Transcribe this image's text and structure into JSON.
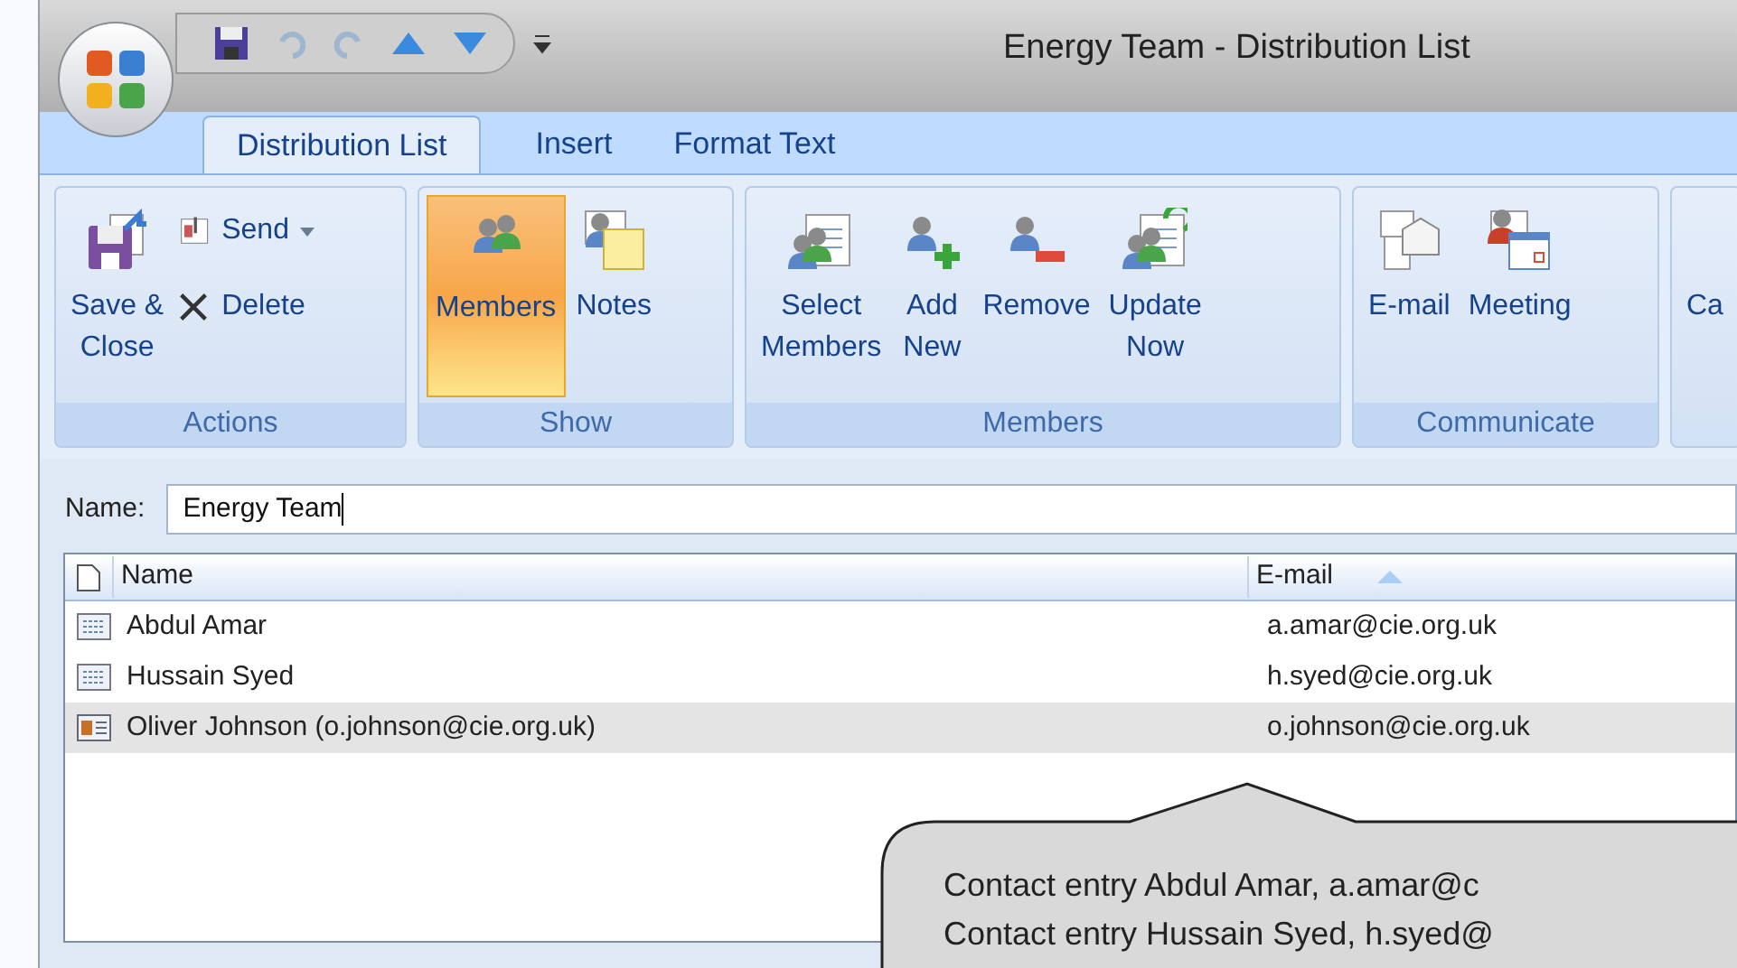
{
  "window": {
    "title": "Energy Team - Distribution List"
  },
  "tabs": [
    {
      "label": "Distribution List",
      "selected": true
    },
    {
      "label": "Insert",
      "selected": false
    },
    {
      "label": "Format Text",
      "selected": false
    }
  ],
  "ribbon": {
    "groups": [
      {
        "label": "Actions",
        "buttons": [
          {
            "kind": "large",
            "label": "Save &\nClose",
            "selected": false
          },
          {
            "kind": "small",
            "label": "Send",
            "dropdown": true,
            "selected": false
          },
          {
            "kind": "small",
            "label": "Delete",
            "dropdown": false,
            "selected": false
          }
        ]
      },
      {
        "label": "Show",
        "buttons": [
          {
            "kind": "large",
            "label": "Members",
            "selected": true
          },
          {
            "kind": "large",
            "label": "Notes",
            "selected": false
          }
        ]
      },
      {
        "label": "Members",
        "buttons": [
          {
            "kind": "large",
            "label": "Select\nMembers",
            "selected": false
          },
          {
            "kind": "large",
            "label": "Add\nNew",
            "selected": false
          },
          {
            "kind": "large",
            "label": "Remove",
            "selected": false
          },
          {
            "kind": "large",
            "label": "Update\nNow",
            "selected": false
          }
        ]
      },
      {
        "label": "Communicate",
        "buttons": [
          {
            "kind": "large",
            "label": "E-mail",
            "selected": false
          },
          {
            "kind": "large",
            "label": "Meeting",
            "selected": false
          }
        ]
      },
      {
        "buttons": [
          {
            "kind": "large",
            "label": "Ca",
            "selected": false
          }
        ]
      }
    ]
  },
  "name_field": {
    "label": "Name:",
    "value": "Energy Team"
  },
  "table": {
    "columns": [
      "Name",
      "E-mail"
    ],
    "rows": [
      {
        "kind": "contact",
        "name": "Abdul Amar",
        "email": "a.amar@cie.org.uk",
        "selected": false
      },
      {
        "kind": "contact",
        "name": "Hussain Syed",
        "email": "h.syed@cie.org.uk",
        "selected": false
      },
      {
        "kind": "user",
        "name": "Oliver Johnson (o.johnson@cie.org.uk)",
        "email": "o.johnson@cie.org.uk",
        "selected": true
      }
    ]
  },
  "callout": {
    "lines": [
      "Contact entry Abdul Amar, a.amar@c",
      "Contact entry Hussain Syed, h.syed@"
    ]
  }
}
